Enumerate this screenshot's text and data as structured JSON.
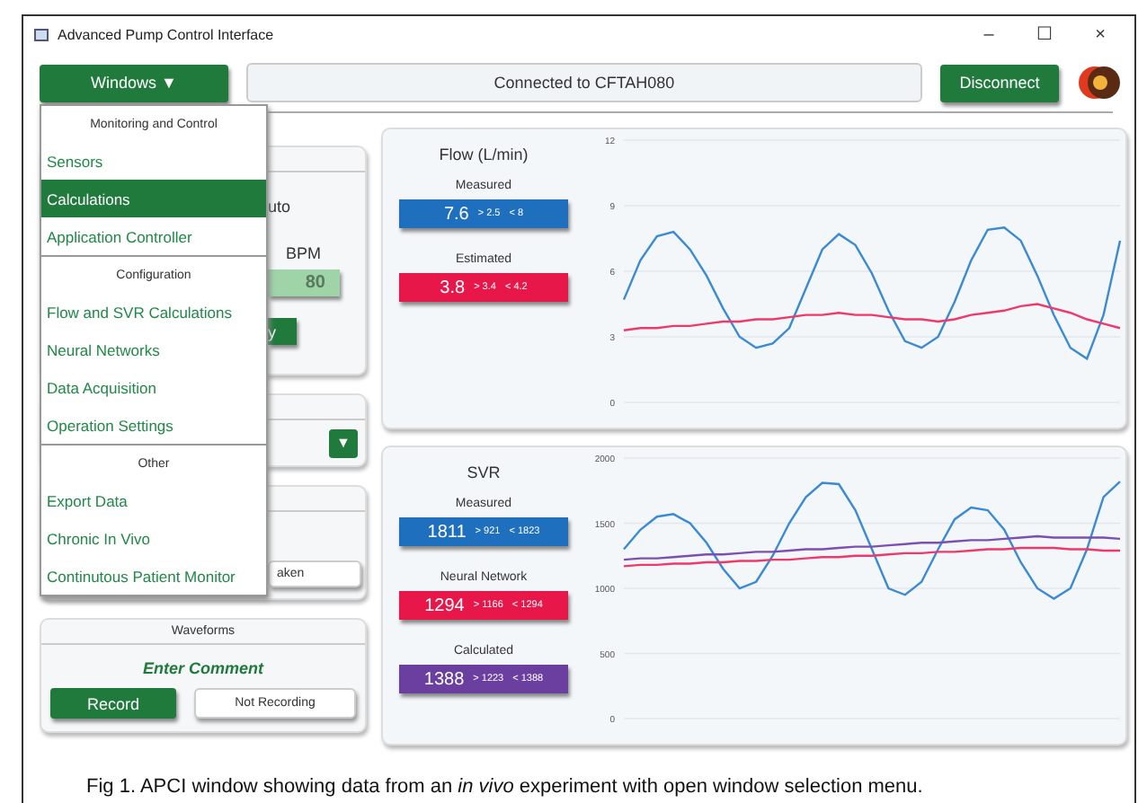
{
  "window": {
    "title": "Advanced Pump Control Interface",
    "controls": [
      "–",
      "☐",
      "×"
    ]
  },
  "toolbar": {
    "menu_button": "Windows ▼",
    "connection": "Connected to CFTAH080",
    "disconnect": "Disconnect"
  },
  "windows_menu": {
    "sections": [
      {
        "header": "Monitoring and Control",
        "items": [
          {
            "label": "Sensors",
            "selected": false
          },
          {
            "label": "Calculations",
            "selected": true
          },
          {
            "label": "Application Controller",
            "selected": false
          }
        ]
      },
      {
        "header": "Configuration",
        "items": [
          {
            "label": "Flow and SVR Calculations",
            "selected": false
          },
          {
            "label": "Neural Networks",
            "selected": false
          },
          {
            "label": "Data Acquisition",
            "selected": false
          },
          {
            "label": "Operation Settings",
            "selected": false
          }
        ]
      },
      {
        "header": "Other",
        "items": [
          {
            "label": "Export Data",
            "selected": false
          },
          {
            "label": "Chronic In Vivo",
            "selected": false
          },
          {
            "label": "Continutous Patient Monitor",
            "selected": false
          }
        ]
      }
    ]
  },
  "control_panel": {
    "mode_text": "uto",
    "bpm_label": "BPM",
    "bpm_value": "80",
    "apply_button": "y"
  },
  "select_panel": {
    "dropdown_button": "▼"
  },
  "sample_panel": {
    "button": "aken"
  },
  "waveforms_panel": {
    "title": "Waveforms",
    "comment": "Enter Comment",
    "record_button": "Record",
    "status": "Not Recording"
  },
  "charts": [
    {
      "title": "Flow (L/min)",
      "readouts": [
        {
          "label": "Measured",
          "value": "7.6",
          "min": "> 2.5",
          "max": "< 8",
          "color": "#1f6fbf"
        },
        {
          "label": "Estimated",
          "value": "3.8",
          "min": "> 3.4",
          "max": "< 4.2",
          "color": "#e8174a"
        }
      ],
      "chart_data": {
        "type": "line",
        "grid": true,
        "ylim": [
          0,
          12
        ],
        "yticks": [
          0,
          3,
          6,
          9,
          12
        ],
        "series": [
          {
            "color": "#3a8ad6",
            "values": [
              4.7,
              6.5,
              7.6,
              7.8,
              7.0,
              5.8,
              4.3,
              3.0,
              2.5,
              2.7,
              3.4,
              5.2,
              7.0,
              7.7,
              7.2,
              5.9,
              4.2,
              2.8,
              2.5,
              3.0,
              4.6,
              6.5,
              7.9,
              8.0,
              7.4,
              5.8,
              4.0,
              2.5,
              2.0,
              4.0,
              7.4
            ]
          },
          {
            "color": "#f0386b",
            "values": [
              3.3,
              3.4,
              3.4,
              3.5,
              3.5,
              3.6,
              3.7,
              3.7,
              3.8,
              3.8,
              3.9,
              4.0,
              4.0,
              4.1,
              4.0,
              4.0,
              3.9,
              3.8,
              3.8,
              3.7,
              3.8,
              4.0,
              4.1,
              4.2,
              4.4,
              4.5,
              4.3,
              4.1,
              3.8,
              3.6,
              3.4
            ]
          }
        ]
      }
    },
    {
      "title": "SVR",
      "readouts": [
        {
          "label": "Measured",
          "value": "1811",
          "min": "> 921",
          "max": "< 1823",
          "color": "#1f6fbf"
        },
        {
          "label": "Neural Network",
          "value": "1294",
          "min": "> 1166",
          "max": "< 1294",
          "color": "#e8174a"
        },
        {
          "label": "Calculated",
          "value": "1388",
          "min": "> 1223",
          "max": "< 1388",
          "color": "#6a3fa0"
        }
      ],
      "chart_data": {
        "type": "line",
        "grid": true,
        "ylim": [
          0,
          2000
        ],
        "yticks": [
          0,
          500,
          1000,
          1500,
          2000
        ],
        "series": [
          {
            "color": "#3a8ad6",
            "values": [
              1300,
              1450,
              1550,
              1570,
              1500,
              1350,
              1150,
              1000,
              1050,
              1250,
              1500,
              1700,
              1810,
              1800,
              1600,
              1300,
              1000,
              950,
              1050,
              1300,
              1530,
              1620,
              1600,
              1450,
              1200,
              1000,
              920,
              1000,
              1300,
              1700,
              1820
            ]
          },
          {
            "color": "#f0386b",
            "values": [
              1170,
              1180,
              1180,
              1190,
              1190,
              1200,
              1200,
              1210,
              1210,
              1220,
              1220,
              1230,
              1240,
              1240,
              1250,
              1250,
              1260,
              1270,
              1270,
              1280,
              1280,
              1290,
              1300,
              1300,
              1310,
              1310,
              1310,
              1300,
              1300,
              1290,
              1290
            ]
          },
          {
            "color": "#7b4fb3",
            "values": [
              1220,
              1230,
              1230,
              1240,
              1250,
              1260,
              1260,
              1270,
              1280,
              1280,
              1290,
              1300,
              1300,
              1310,
              1320,
              1320,
              1330,
              1340,
              1350,
              1350,
              1360,
              1370,
              1370,
              1380,
              1390,
              1400,
              1390,
              1390,
              1390,
              1390,
              1380
            ]
          }
        ]
      }
    }
  ],
  "caption": "Fig 1. APCI window showing data from an *in vivo* experiment with open window selection menu."
}
